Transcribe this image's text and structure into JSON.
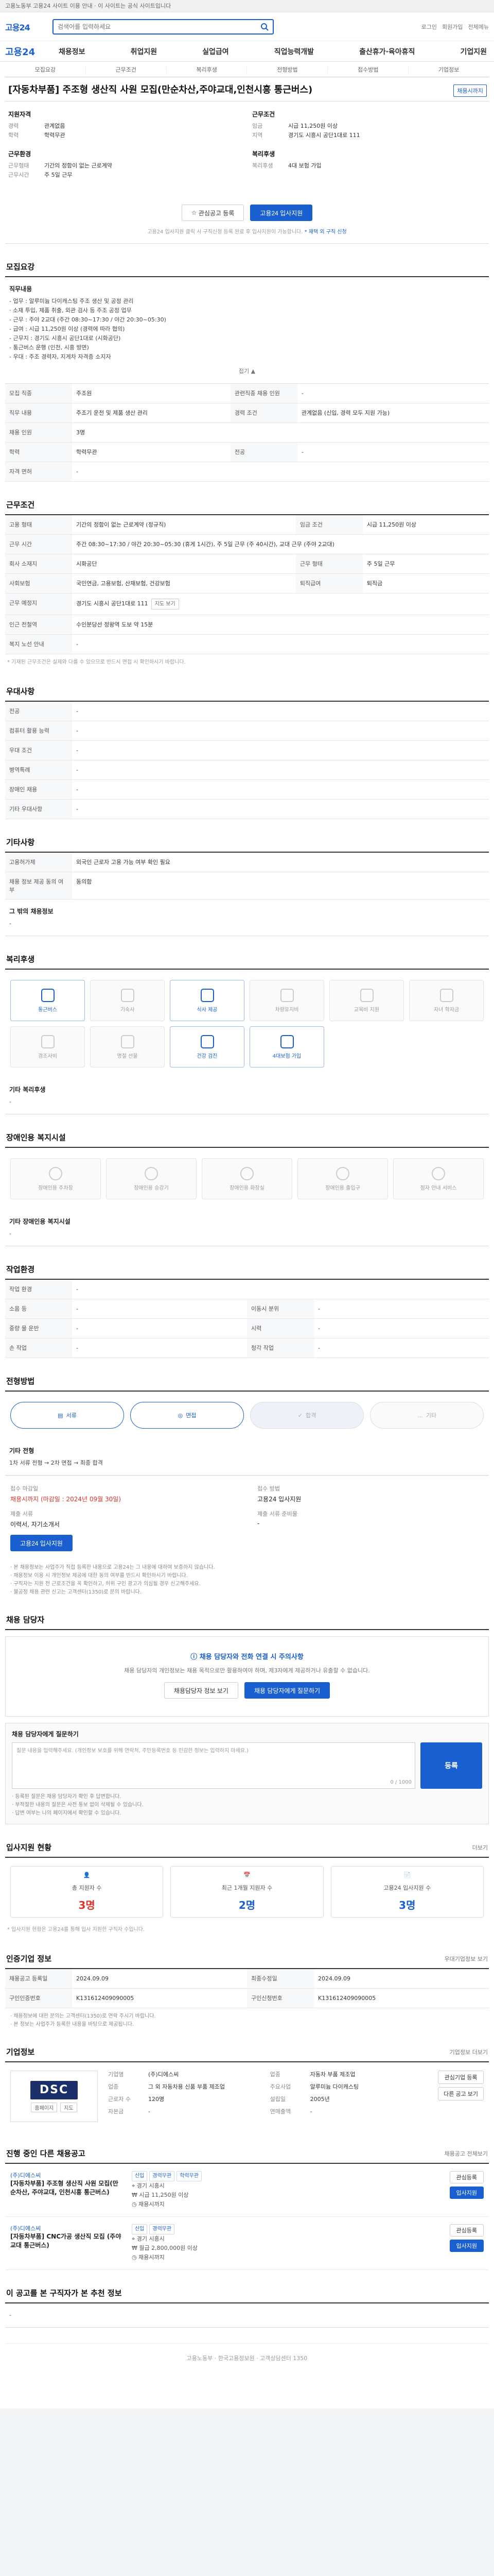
{
  "topbar": {
    "text": "고용노동부 고용24 사이트 이용 안내 · 이 사이트는 공식 사이트입니다"
  },
  "header": {
    "brand": "고용24",
    "search_placeholder": "검색어를 입력하세요",
    "util_links": [
      "로그인",
      "회원가입",
      "전체메뉴"
    ]
  },
  "gnb": {
    "logo": "고용24",
    "menu": [
      "채용정보",
      "취업지원",
      "실업급여",
      "직업능력개발",
      "출산휴가·육아휴직",
      "기업지원"
    ]
  },
  "section_tabs": [
    "모집요강",
    "근무조건",
    "복리후생",
    "전형방법",
    "접수방법",
    "기업정보"
  ],
  "job": {
    "title": "[자동차부품] 주조형 생산직 사원 모집(만순차산,주야교대,인천시흥 통근버스)",
    "status_badge": "채용시까지",
    "groups": {
      "left": [
        {
          "heading": "지원자격",
          "rows": [
            {
              "k": "경력",
              "v": "관계없음"
            },
            {
              "k": "학력",
              "v": "학력무관"
            }
          ]
        },
        {
          "heading": "근무환경",
          "rows": [
            {
              "k": "근무형태",
              "v": "기간의 정함이 없는 근로계약"
            },
            {
              "k": "근무시간",
              "v": "주 5일 근무"
            }
          ]
        }
      ],
      "right": [
        {
          "heading": "근무조건",
          "rows": [
            {
              "k": "임금",
              "v": "시급 11,250원 이상"
            },
            {
              "k": "지역",
              "v": "경기도 시흥시 공단1대로 111"
            }
          ]
        },
        {
          "heading": "복리후생",
          "rows": [
            {
              "k": "복리후생",
              "v": "4대 보험 가입"
            }
          ]
        }
      ]
    },
    "buttons": {
      "scrap": "관심공고 등록",
      "apply": "고용24 입사지원"
    },
    "notice": "고용24 입사지원 클릭 시 구직신청 등록 완료 후 입사지원이 가능합니다.",
    "notice_link": "* 재택 외 구직 신청"
  },
  "recruit": {
    "title": "모집요강",
    "desc_heading": "직무내용",
    "desc_lines": [
      "- 업무 : 알루미늄 다이캐스팅 주조 생산 및 공정 관리",
      "  · 소재 투입, 제품 취출, 외관 검사 등 주조 공정 업무",
      "- 근무 : 주야 2교대 (주간 08:30~17:30 / 야간 20:30~05:30)",
      "- 급여 : 시급 11,250원 이상 (경력에 따라 협의)",
      "- 근무지 : 경기도 시흥시 공단1대로 (시화공단)",
      "- 통근버스 운행 (인천, 시흥 방면)",
      "- 우대 : 주조 경력자, 지게차 자격증 소지자"
    ],
    "fold": "접기 ▲",
    "rows": [
      {
        "k": "모집 직종",
        "v": "주조원",
        "k2": "관련직종 채용 인원",
        "v2": "-"
      },
      {
        "k": "직무 내용",
        "v": "주조기 운전 및 제품 생산 관리",
        "k2": "경력 조건",
        "v2": "관계없음 (신입, 경력 모두 지원 가능)"
      },
      {
        "k": "채용 인원",
        "v": "3명",
        "k2": "",
        "v2": ""
      },
      {
        "k": "학력",
        "v": "학력무관",
        "k2": "전공",
        "v2": "-"
      },
      {
        "k": "자격 면허",
        "v": "-",
        "k2": "",
        "v2": ""
      }
    ]
  },
  "work": {
    "title": "근무조건",
    "rows": [
      {
        "k": "고용 형태",
        "v": "기간의 정함이 없는 근로계약 (정규직)",
        "k2": "임금 조건",
        "v2": "시급 11,250원 이상"
      },
      {
        "k": "근무 시간",
        "v": "주간 08:30~17:30 / 야간 20:30~05:30 (휴게 1시간), 주 5일 근무 (주 40시간), 교대 근무 (주야 2교대)",
        "k2": "",
        "v2": ""
      },
      {
        "k": "회사 소재지",
        "v": "시화공단",
        "k2": "근무 형태",
        "v2": "주 5일 근무"
      },
      {
        "k": "사회보험",
        "v": "국민연금, 고용보험, 산재보험, 건강보험",
        "k2": "퇴직급여",
        "v2": "퇴직금"
      },
      {
        "k": "근무 예정지",
        "v": "경기도 시흥시 공단1대로 111",
        "k2": "",
        "v2": ""
      },
      {
        "k": "인근 전철역",
        "v": "수인분당선 정왕역 도보 약 15분",
        "k2": "",
        "v2": ""
      },
      {
        "k": "복지 노선 안내",
        "v": "-",
        "k2": "",
        "v2": ""
      }
    ],
    "map_button": "지도 보기",
    "note": "* 기재된 근무조건은 실제와 다를 수 있으므로 반드시 면접 시 확인하시기 바랍니다."
  },
  "prefer": {
    "title": "우대사항",
    "rows": [
      {
        "k": "전공",
        "v": "-"
      },
      {
        "k": "컴퓨터 활용 능력",
        "v": "-"
      },
      {
        "k": "우대 조건",
        "v": "-"
      },
      {
        "k": "병역특례",
        "v": "-"
      },
      {
        "k": "장애인 채용",
        "v": "-"
      },
      {
        "k": "기타 우대사항",
        "v": "-"
      }
    ]
  },
  "etc": {
    "title": "기타사항",
    "rows": [
      {
        "k": "고용허가제",
        "v": "외국인 근로자 고용 가능 여부 확인 필요"
      },
      {
        "k": "채용 정보 제공 동의 여부",
        "v": "동의함"
      }
    ],
    "extra_heading": "그 밖의 채용정보",
    "extra_value": "-"
  },
  "welfare": {
    "title": "복리후생",
    "cards": [
      {
        "label": "통근버스",
        "on": true
      },
      {
        "label": "기숙사",
        "on": false
      },
      {
        "label": "식사 제공",
        "on": true
      },
      {
        "label": "차량유지비",
        "on": false
      },
      {
        "label": "교육비 지원",
        "on": false
      },
      {
        "label": "자녀 학자금",
        "on": false
      },
      {
        "label": "경조사비",
        "on": false
      },
      {
        "label": "명절 선물",
        "on": false
      },
      {
        "label": "건강 검진",
        "on": true
      },
      {
        "label": "4대보험 가입",
        "on": true
      }
    ],
    "etc_heading": "기타 복리후생",
    "etc_value": "-"
  },
  "disability": {
    "title": "장애인용 복지시설",
    "cards": [
      "장애인용 주차장",
      "장애인용 승강기",
      "장애인용 화장실",
      "장애인용 출입구",
      "점자 안내 서비스"
    ],
    "etc_heading": "기타 장애인용 복지시설",
    "etc_value": "-"
  },
  "workplace": {
    "title": "작업환경",
    "rows": [
      {
        "k": "작업 환경",
        "v": "-",
        "k2": "",
        "v2": ""
      },
      {
        "k": "소음 등",
        "v": "-",
        "k2": "이동시 분위",
        "v2": "-"
      },
      {
        "k": "중량 물 운반",
        "v": "-",
        "k2": "시력",
        "v2": "-"
      },
      {
        "k": "손 작업",
        "v": "-",
        "k2": "청각 작업",
        "v2": "-"
      }
    ]
  },
  "selection": {
    "title": "전형방법",
    "steps": [
      "서류",
      "면접",
      "합격",
      "기타"
    ],
    "active_steps": [
      0,
      1
    ],
    "current_step": 2,
    "label": "기타 전형",
    "desc": "1차 서류 전형 → 2차 면접 → 최종 합격",
    "cols": [
      {
        "h": "접수 마감일",
        "v": "채용시까지 (마감일 : 2024년 09월 30일)",
        "red": true,
        "h2": "접수 방법",
        "v2": "고용24 입사지원"
      },
      {
        "h": "제출 서류",
        "v": "이력서, 자기소개서",
        "red": false,
        "h2": "제출 서류 준비물",
        "v2": "-"
      }
    ],
    "apply_button": "고용24 입사지원",
    "bullets": [
      "· 본 채용정보는 사업주가 직접 등록한 내용으로 고용24는 그 내용에 대하여 보증하지 않습니다.",
      "· 채용정보 이용 시 개인정보 제공에 대한 동의 여부를 반드시 확인하시기 바랍니다.",
      "· 구직자는 지원 전 근로조건을 꼭 확인하고, 허위 구인 광고가 의심될 경우 신고해주세요.",
      "· 불공정 채용 관련 신고는 고객센터(1350)로 문의 바랍니다."
    ]
  },
  "contact": {
    "title": "채용 담당자",
    "line1": "채용 담당자와 전화 연결 시 주의사항",
    "line2": "채용 담당자의 개인정보는 채용 목적으로만 활용하여야 하며, 제3자에게 제공하거나 유출할 수 없습니다.",
    "btn1": "채용담당자 정보 보기",
    "btn2": "채용 담당자에게 질문하기"
  },
  "qa": {
    "title": "채용 담당자에게 질문하기",
    "placeholder": "질문 내용을 입력해주세요. (개인정보 보호를 위해 연락처, 주민등록번호 등 민감한 정보는 입력하지 마세요.)",
    "counter": "0 / 1000",
    "submit": "등록",
    "notes": [
      "· 등록된 질문은 채용 담당자가 확인 후 답변합니다.",
      "· 부적절한 내용의 질문은 사전 통보 없이 삭제될 수 있습니다.",
      "· 답변 여부는 나의 페이지에서 확인할 수 있습니다."
    ]
  },
  "stats": {
    "title": "입사지원 현황",
    "more": "더보기",
    "items": [
      {
        "label": "총 지원자 수",
        "num": "3명",
        "blue": false
      },
      {
        "label": "최근 1개월 지원자 수",
        "num": "2명",
        "blue": true
      },
      {
        "label": "고용24 입사지원 수",
        "num": "3명",
        "blue": true
      }
    ],
    "note": "* 입사지원 현황은 고용24를 통해 입사 지원한 구직자 수입니다."
  },
  "manage": {
    "title": "인증기업 정보",
    "more": "우대기업정보 보기",
    "rows": [
      {
        "k": "채용공고 등록일",
        "v": "2024.09.09",
        "k2": "최종수정일",
        "v2": "2024.09.09"
      },
      {
        "k": "구인인증번호",
        "v": "K131612409090005",
        "k2": "구인신청번호",
        "v2": "K131612409090005"
      }
    ],
    "notes": [
      "· 채용정보에 대한 문의는 고객센터(1350)로 연락 주시기 바랍니다.",
      "· 본 정보는 사업주가 등록한 내용을 바탕으로 제공됩니다."
    ]
  },
  "company": {
    "title": "기업정보",
    "more": "기업정보 더보기",
    "logo_main": "DSC",
    "rows": [
      {
        "k": "기업명",
        "v": "(주)디에스씨",
        "k2": "업종",
        "v2": "자동차 부품 제조업"
      },
      {
        "k": "업종",
        "v": "그 외 자동차용 신품 부품 제조업",
        "k2": "주요사업",
        "v2": "알루미늄 다이캐스팅"
      },
      {
        "k": "근로자 수",
        "v": "120명",
        "k2": "설립일",
        "v2": "2005년"
      },
      {
        "k": "자본금",
        "v": "-",
        "k2": "연매출액",
        "v2": "-"
      }
    ],
    "btn_follow": "관심기업 등록",
    "btn_more": "다른 공고 보기",
    "mini_buttons": [
      "홈페이지",
      "지도"
    ]
  },
  "related": {
    "title": "진행 중인 다른 채용공고",
    "more": "채용공고 전체보기",
    "items": [
      {
        "company": "(주)디에스씨",
        "title": "[자동차부품] 주조형 생산직 사원 모집(만순차산, 주야교대, 인천시흥 통근버스)",
        "tags": [
          "신입",
          "경력무관",
          "학력무관"
        ],
        "meta": [
          "경기 시흥시",
          "시급 11,250원 이상",
          "채용시까지"
        ]
      },
      {
        "company": "(주)디에스씨",
        "title": "[자동차부품] CNC가공 생산직 모집 (주야교대 통근버스)",
        "tags": [
          "신입",
          "경력무관"
        ],
        "meta": [
          "경기 시흥시",
          "월급 2,800,000원 이상",
          "채용시까지"
        ]
      }
    ],
    "btn_scrap": "관심등록",
    "btn_apply": "입사지원"
  },
  "recommend": {
    "title": "이 공고를 본 구직자가 본 추천 정보",
    "value": "-"
  },
  "footer": {
    "text": "고용노동부 · 한국고용정보원 · 고객상담센터 1350"
  }
}
